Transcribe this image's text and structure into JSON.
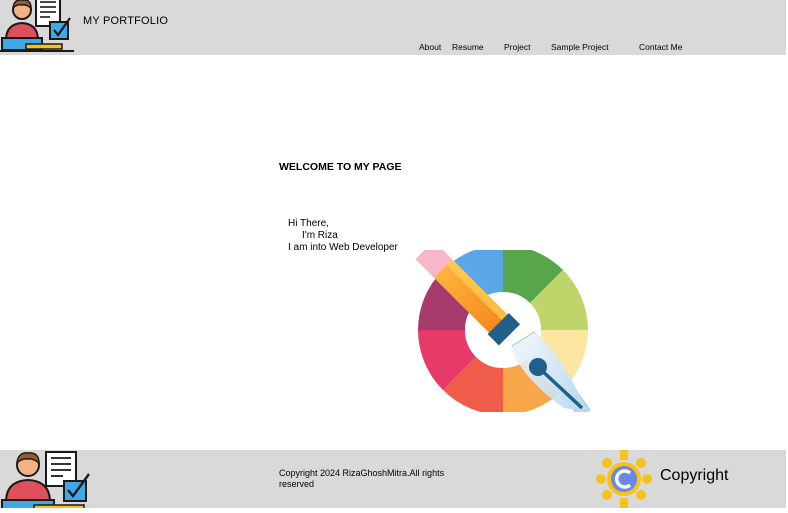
{
  "header": {
    "brand": "MY PORTFOLIO",
    "nav": [
      {
        "label": "About"
      },
      {
        "label": "Resume"
      },
      {
        "label": "Project"
      },
      {
        "label": "Sample Project"
      },
      {
        "label": "Contact Me"
      }
    ]
  },
  "main": {
    "welcome": "WELCOME TO MY PAGE",
    "intro_line1": "Hi  There,",
    "intro_line2": "I'm Riza",
    "intro_line3": "I am into Web Developer"
  },
  "footer": {
    "copyright_text": "Copyright 2024 RizaGhoshMitra.All rights reserved",
    "copyright_label": "Copyright"
  },
  "colors": {
    "bar_background": "#d9d9d9",
    "page_background": "#ffffff",
    "text": "#000000",
    "copyright_icon_yellow": "#f7c21c",
    "copyright_icon_blue": "#6a86e6"
  },
  "icons": {
    "header_logo": "developer-avatar-icon",
    "hero_image": "pen-and-color-wheel-icon",
    "footer_logo": "developer-avatar-icon",
    "copyright": "copyright-icon"
  }
}
